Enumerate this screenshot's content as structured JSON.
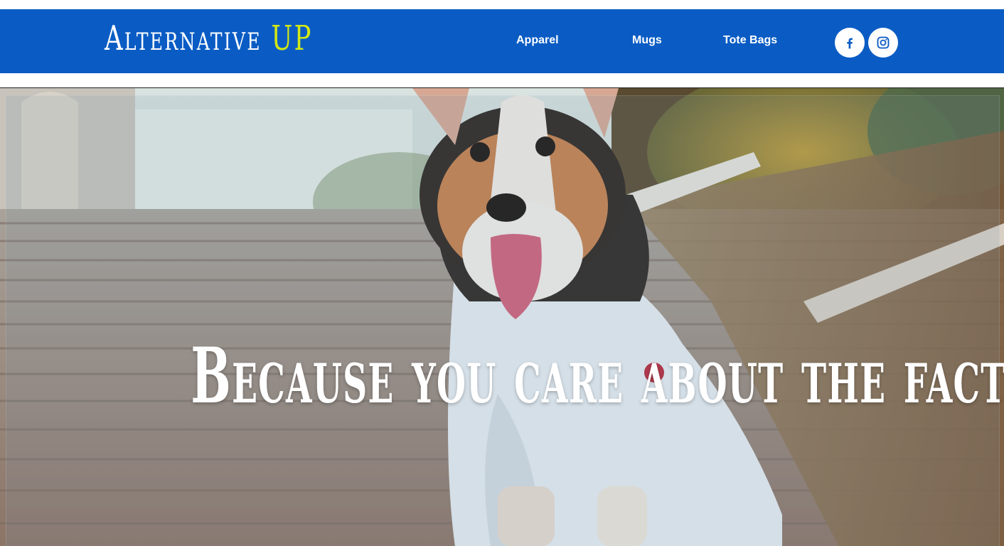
{
  "brand": {
    "logo_main": "Alternative",
    "logo_accent": "UP"
  },
  "nav": {
    "items": [
      {
        "label": "Apparel"
      },
      {
        "label": "Mugs"
      },
      {
        "label": "Tote Bags"
      }
    ]
  },
  "social": [
    {
      "icon": "facebook-icon"
    },
    {
      "icon": "instagram-icon"
    }
  ],
  "hero": {
    "title": "Because you care about the facts",
    "image": "corgi-on-stairs-photo"
  },
  "colors": {
    "header_bg": "#0a5cc4",
    "logo_accent": "#d2e814",
    "text": "#ffffff"
  }
}
